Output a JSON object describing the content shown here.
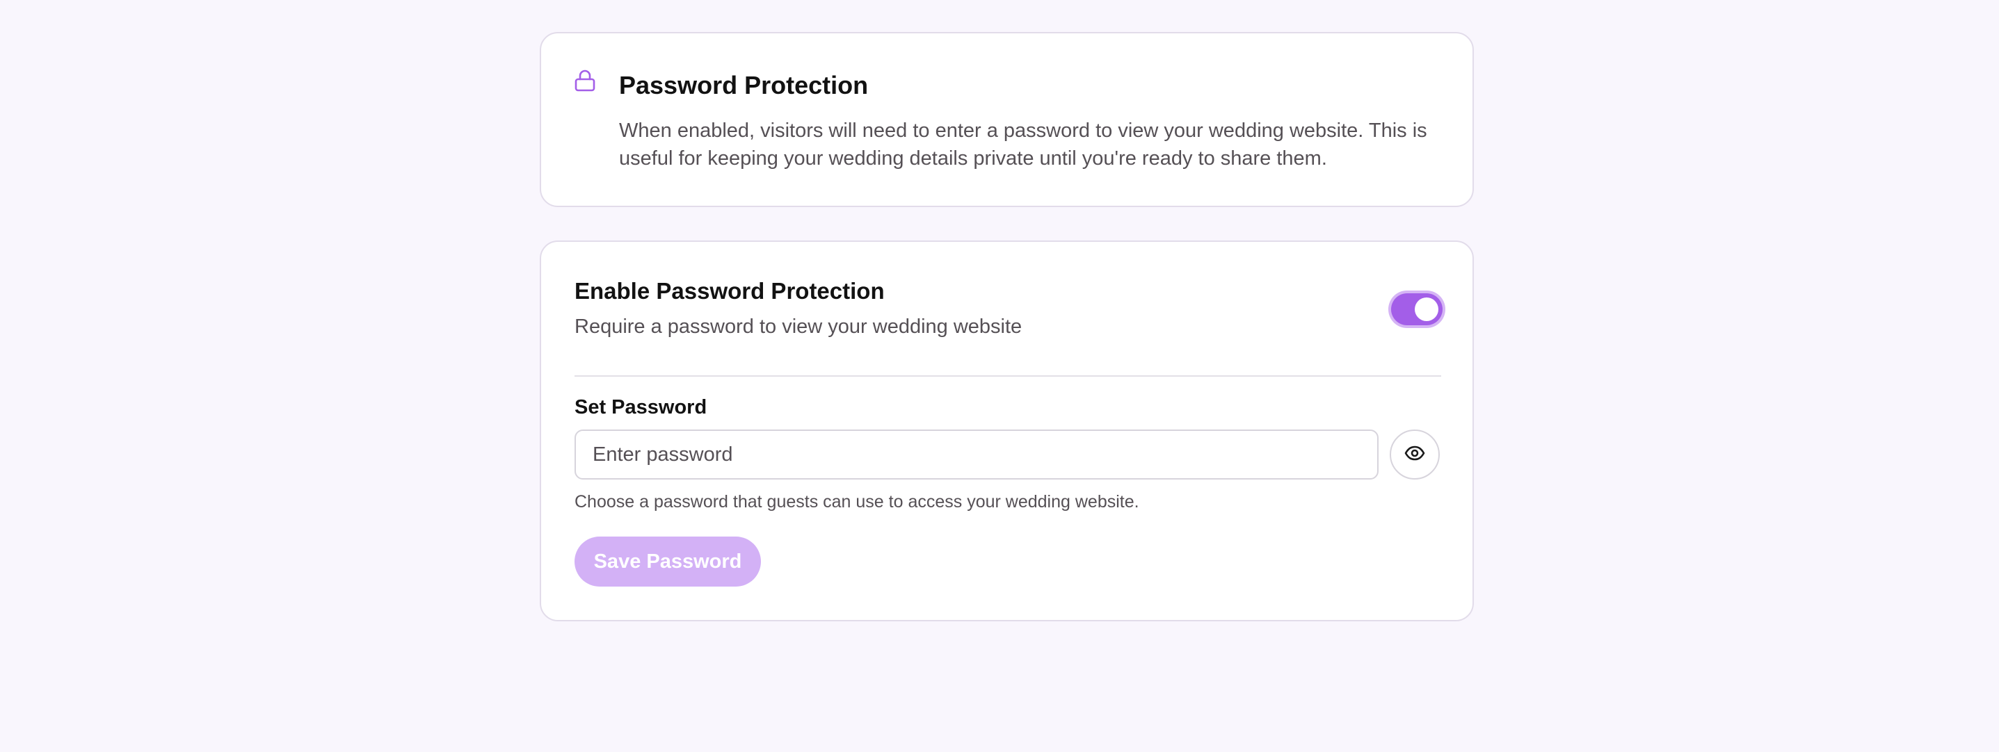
{
  "info_card": {
    "icon": "lock-icon",
    "title": "Password Protection",
    "description": "When enabled, visitors will need to enter a password to view your wedding website. This is useful for keeping your wedding details private until you're ready to share them."
  },
  "settings_card": {
    "toggle_title": "Enable Password Protection",
    "toggle_subtitle": "Require a password to view your wedding website",
    "toggle_enabled": true,
    "field_label": "Set Password",
    "password_value": "",
    "password_placeholder": "Enter password",
    "show_password_icon": "eye-icon",
    "hint": "Choose a password that guests can use to access your wedding website.",
    "save_label": "Save Password"
  },
  "colors": {
    "accent": "#a35ee8",
    "accent_disabled": "#d3b1f6",
    "background": "#f9f6fd"
  }
}
